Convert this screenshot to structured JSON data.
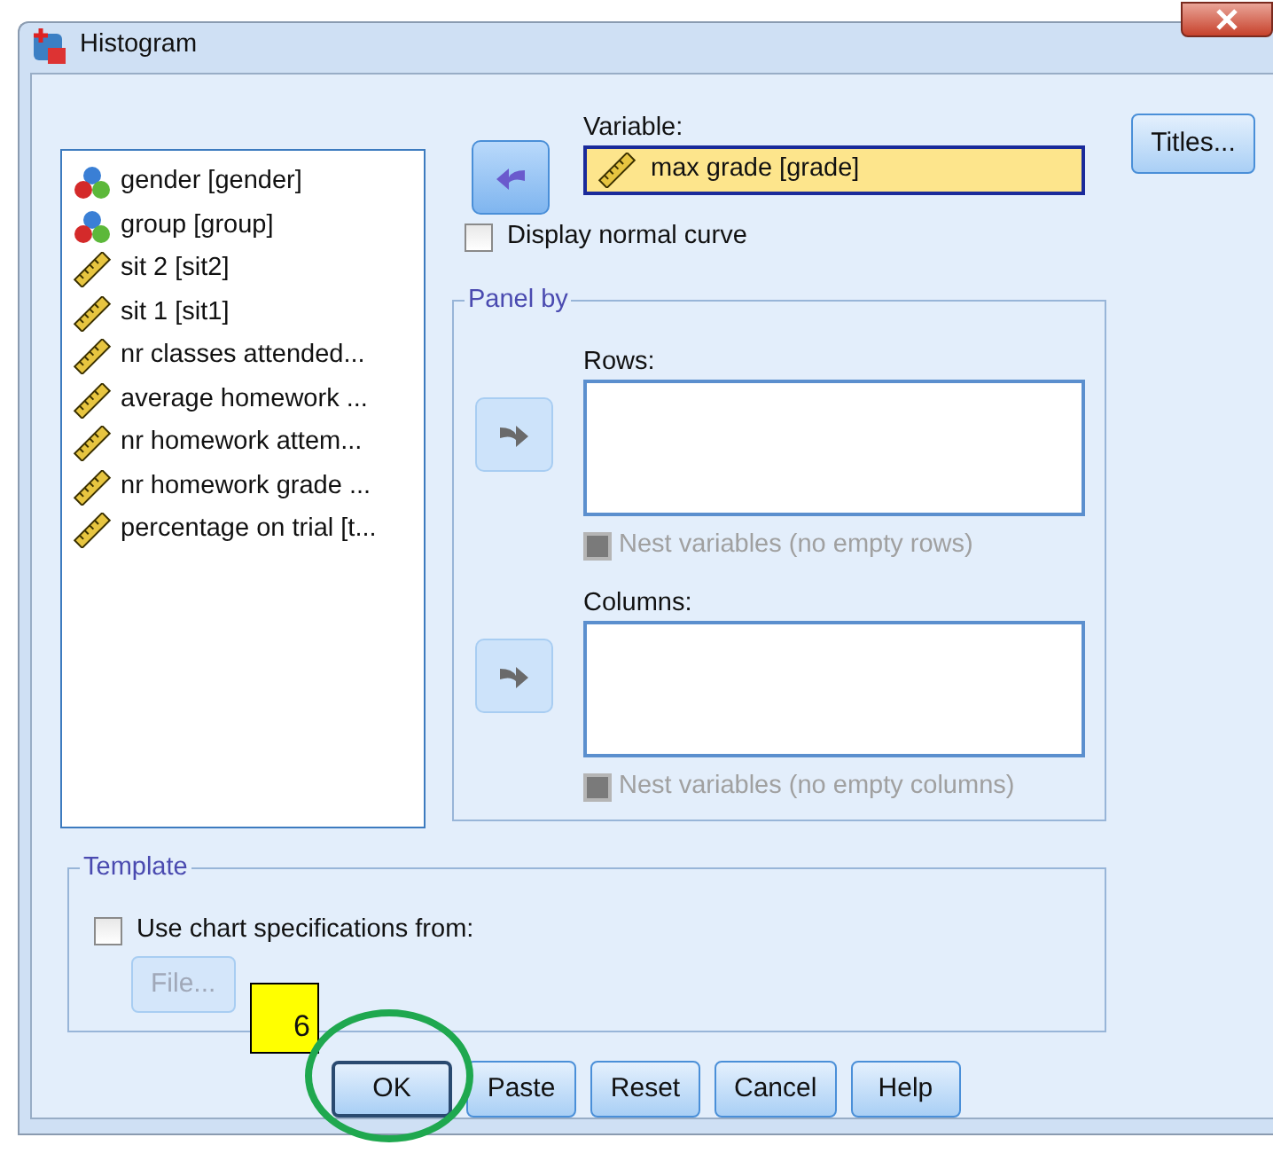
{
  "window": {
    "title": "Histogram"
  },
  "variables": [
    {
      "label": "gender [gender]",
      "kind": "nominal"
    },
    {
      "label": "group [group]",
      "kind": "nominal"
    },
    {
      "label": "sit 2 [sit2]",
      "kind": "scale"
    },
    {
      "label": "sit 1 [sit1]",
      "kind": "scale"
    },
    {
      "label": "nr classes attended...",
      "kind": "scale"
    },
    {
      "label": "average homework ...",
      "kind": "scale"
    },
    {
      "label": "nr homework attem...",
      "kind": "scale"
    },
    {
      "label": "nr homework grade ...",
      "kind": "scale"
    },
    {
      "label": "percentage on trial [t...",
      "kind": "scale"
    }
  ],
  "variable": {
    "label": "Variable:",
    "value": "max grade [grade]",
    "kind": "scale"
  },
  "normal_curve": {
    "label": "Display normal curve",
    "checked": false
  },
  "panel_by": {
    "title": "Panel by",
    "rows": {
      "label": "Rows:",
      "nest_label": "Nest variables (no empty rows)",
      "nest_disabled": true
    },
    "columns": {
      "label": "Columns:",
      "nest_label": "Nest variables (no empty columns)",
      "nest_disabled": true
    }
  },
  "titles_button": "Titles...",
  "template": {
    "title": "Template",
    "checkbox_label": "Use chart specifications from:",
    "checked": false,
    "file_button": "File...",
    "file_disabled": true
  },
  "buttons": [
    {
      "label": "OK",
      "selected": true
    },
    {
      "label": "Paste",
      "selected": false
    },
    {
      "label": "Reset",
      "selected": false
    },
    {
      "label": "Cancel",
      "selected": false
    },
    {
      "label": "Help",
      "selected": false
    }
  ],
  "annotation": {
    "number": "6"
  }
}
